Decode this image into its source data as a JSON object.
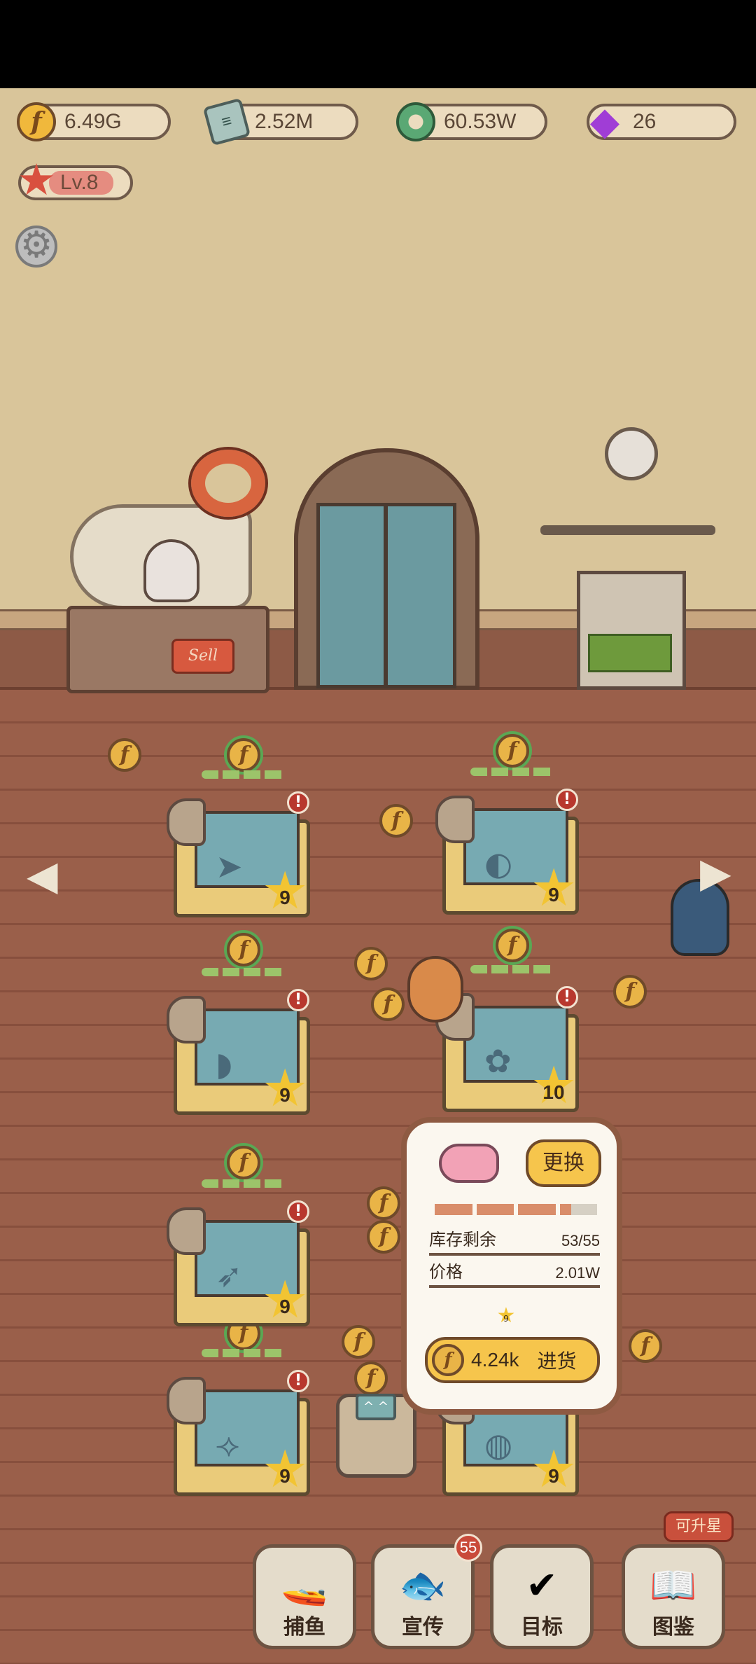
{
  "resources": [
    {
      "icon": "gold-coin-icon",
      "value": "6.49G"
    },
    {
      "icon": "cash-stack-icon",
      "value": "2.52M"
    },
    {
      "icon": "green-ring-icon",
      "value": "60.53W"
    },
    {
      "icon": "purple-gem-icon",
      "value": "26"
    }
  ],
  "player": {
    "level_label": "Lv.8"
  },
  "shop": {
    "sell_sign": "Sell"
  },
  "tanks": [
    {
      "star": "9",
      "fish": "shark"
    },
    {
      "star": "9",
      "fish": "flatfish"
    },
    {
      "star": "9",
      "fish": "sunfish"
    },
    {
      "star": "10",
      "fish": "turtle"
    },
    {
      "star": "9",
      "fish": "swordfish"
    },
    {
      "star": "9",
      "fish": "small-fish"
    },
    {
      "star": "9",
      "fish": "pufferfish"
    }
  ],
  "popup": {
    "swap_label": "更换",
    "stock_label": "库存剩余",
    "stock_value": "53/55",
    "stock_fraction": 0.96,
    "price_label": "价格",
    "price_value": "2.01W",
    "star_level": "9",
    "restock_cost": "4.24k",
    "restock_label": "进货"
  },
  "robot_face": "^ ^",
  "bottom_nav": [
    {
      "label": "捕鱼",
      "icon": "submarine-icon"
    },
    {
      "label": "宣传",
      "icon": "flyer-icon",
      "badge": "55"
    },
    {
      "label": "目标",
      "icon": "checklist-icon"
    },
    {
      "label": "图鉴",
      "icon": "fish-book-icon",
      "tag": "可升星"
    }
  ],
  "colors": {
    "coin": "#e9b447",
    "floor": "#9a5f4a",
    "wall": "#d9c59a",
    "button": "#f6c54c"
  }
}
